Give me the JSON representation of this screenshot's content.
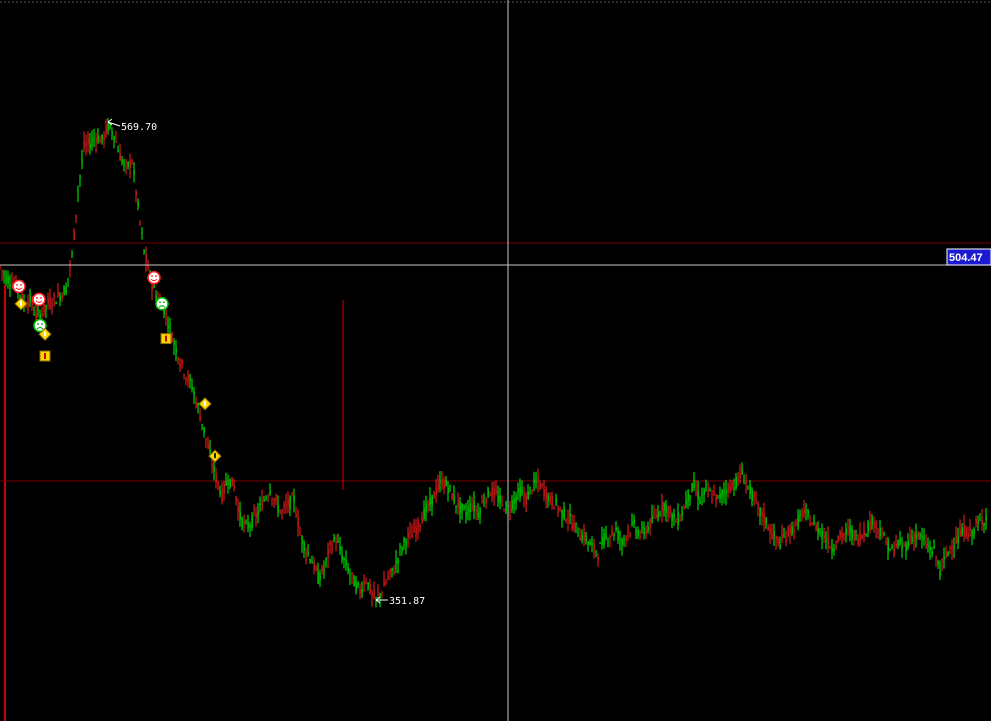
{
  "chart_data": {
    "type": "candlestick",
    "title": "",
    "y_range": [
      351.87,
      569.7
    ],
    "high_label": "569.70",
    "low_label": "351.87",
    "crosshair_price_label": "504.47",
    "series": [
      {
        "name": "",
        "points": [
          [
            0,
            505
          ],
          [
            6,
            500
          ],
          [
            12,
            498
          ],
          [
            18,
            495
          ],
          [
            24,
            488
          ],
          [
            30,
            490
          ],
          [
            36,
            482
          ],
          [
            42,
            484
          ],
          [
            48,
            488
          ],
          [
            54,
            490
          ],
          [
            60,
            492
          ],
          [
            66,
            495
          ],
          [
            72,
            510
          ],
          [
            78,
            540
          ],
          [
            84,
            560
          ],
          [
            90,
            562
          ],
          [
            96,
            565
          ],
          [
            102,
            563
          ],
          [
            108,
            569.7
          ],
          [
            114,
            566
          ],
          [
            120,
            556
          ],
          [
            126,
            550
          ],
          [
            132,
            554
          ],
          [
            138,
            532
          ],
          [
            144,
            512
          ],
          [
            150,
            500
          ],
          [
            156,
            492
          ],
          [
            162,
            488
          ],
          [
            168,
            480
          ],
          [
            174,
            470
          ],
          [
            180,
            462
          ],
          [
            186,
            455
          ],
          [
            192,
            450
          ],
          [
            198,
            440
          ],
          [
            204,
            430
          ],
          [
            210,
            418
          ],
          [
            216,
            408
          ],
          [
            222,
            400
          ],
          [
            228,
            408
          ],
          [
            234,
            404
          ],
          [
            240,
            390
          ],
          [
            246,
            385
          ],
          [
            252,
            388
          ],
          [
            258,
            392
          ],
          [
            264,
            398
          ],
          [
            270,
            403
          ],
          [
            276,
            396
          ],
          [
            282,
            392
          ],
          [
            288,
            396
          ],
          [
            294,
            398
          ],
          [
            300,
            382
          ],
          [
            306,
            375
          ],
          [
            312,
            370
          ],
          [
            318,
            362
          ],
          [
            324,
            366
          ],
          [
            330,
            376
          ],
          [
            336,
            380
          ],
          [
            342,
            372
          ],
          [
            348,
            366
          ],
          [
            354,
            360
          ],
          [
            360,
            356
          ],
          [
            366,
            362
          ],
          [
            372,
            354
          ],
          [
            376,
            351.87
          ],
          [
            382,
            356
          ],
          [
            388,
            362
          ],
          [
            394,
            366
          ],
          [
            400,
            374
          ],
          [
            406,
            380
          ],
          [
            412,
            382
          ],
          [
            418,
            386
          ],
          [
            424,
            392
          ],
          [
            430,
            396
          ],
          [
            436,
            402
          ],
          [
            442,
            406
          ],
          [
            448,
            404
          ],
          [
            454,
            398
          ],
          [
            460,
            394
          ],
          [
            466,
            392
          ],
          [
            472,
            396
          ],
          [
            478,
            392
          ],
          [
            484,
            398
          ],
          [
            490,
            402
          ],
          [
            496,
            400
          ],
          [
            502,
            396
          ],
          [
            508,
            394
          ],
          [
            514,
            398
          ],
          [
            520,
            402
          ],
          [
            526,
            398
          ],
          [
            532,
            404
          ],
          [
            538,
            406
          ],
          [
            544,
            402
          ],
          [
            550,
            398
          ],
          [
            556,
            396
          ],
          [
            562,
            392
          ],
          [
            568,
            390
          ],
          [
            574,
            386
          ],
          [
            580,
            382
          ],
          [
            586,
            380
          ],
          [
            592,
            376
          ],
          [
            598,
            374
          ],
          [
            604,
            380
          ],
          [
            610,
            382
          ],
          [
            616,
            384
          ],
          [
            622,
            378
          ],
          [
            628,
            384
          ],
          [
            634,
            386
          ],
          [
            640,
            382
          ],
          [
            646,
            384
          ],
          [
            652,
            388
          ],
          [
            658,
            392
          ],
          [
            664,
            396
          ],
          [
            670,
            392
          ],
          [
            676,
            388
          ],
          [
            682,
            392
          ],
          [
            688,
            400
          ],
          [
            694,
            404
          ],
          [
            700,
            398
          ],
          [
            706,
            402
          ],
          [
            712,
            400
          ],
          [
            718,
            398
          ],
          [
            724,
            402
          ],
          [
            730,
            404
          ],
          [
            736,
            406
          ],
          [
            742,
            410
          ],
          [
            748,
            404
          ],
          [
            754,
            398
          ],
          [
            760,
            392
          ],
          [
            766,
            388
          ],
          [
            772,
            382
          ],
          [
            778,
            378
          ],
          [
            784,
            380
          ],
          [
            790,
            384
          ],
          [
            796,
            386
          ],
          [
            802,
            392
          ],
          [
            808,
            390
          ],
          [
            814,
            386
          ],
          [
            820,
            384
          ],
          [
            826,
            380
          ],
          [
            832,
            376
          ],
          [
            838,
            380
          ],
          [
            844,
            382
          ],
          [
            850,
            384
          ],
          [
            856,
            380
          ],
          [
            862,
            382
          ],
          [
            868,
            386
          ],
          [
            874,
            388
          ],
          [
            880,
            384
          ],
          [
            886,
            378
          ],
          [
            892,
            374
          ],
          [
            898,
            378
          ],
          [
            904,
            376
          ],
          [
            910,
            380
          ],
          [
            916,
            382
          ],
          [
            922,
            380
          ],
          [
            928,
            376
          ],
          [
            934,
            374
          ],
          [
            940,
            366
          ],
          [
            946,
            372
          ],
          [
            952,
            378
          ],
          [
            958,
            380
          ],
          [
            964,
            384
          ],
          [
            970,
            382
          ],
          [
            976,
            386
          ],
          [
            982,
            388
          ],
          [
            988,
            392
          ]
        ]
      }
    ],
    "markers": [
      {
        "kind": "smiley-happy",
        "x": 19,
        "price": 496
      },
      {
        "kind": "smiley-happy",
        "x": 39,
        "price": 490
      },
      {
        "kind": "smiley-sad",
        "x": 40,
        "price": 478
      },
      {
        "kind": "diamond",
        "x": 21,
        "price": 488
      },
      {
        "kind": "diamond",
        "x": 45,
        "price": 474
      },
      {
        "kind": "square-alert",
        "x": 45,
        "price": 464
      },
      {
        "kind": "smiley-happy",
        "x": 154,
        "price": 500
      },
      {
        "kind": "smiley-sad",
        "x": 162,
        "price": 488
      },
      {
        "kind": "square-alert",
        "x": 166,
        "price": 472
      },
      {
        "kind": "diamond",
        "x": 205,
        "price": 442
      },
      {
        "kind": "diamond-alert",
        "x": 215,
        "price": 418
      }
    ],
    "colors": {
      "up": "#ff2020",
      "down": "#00ff00",
      "crosshair": "#c8c8c8",
      "refline": "#7a0000",
      "badge_bg": "#1a1ad0"
    }
  }
}
